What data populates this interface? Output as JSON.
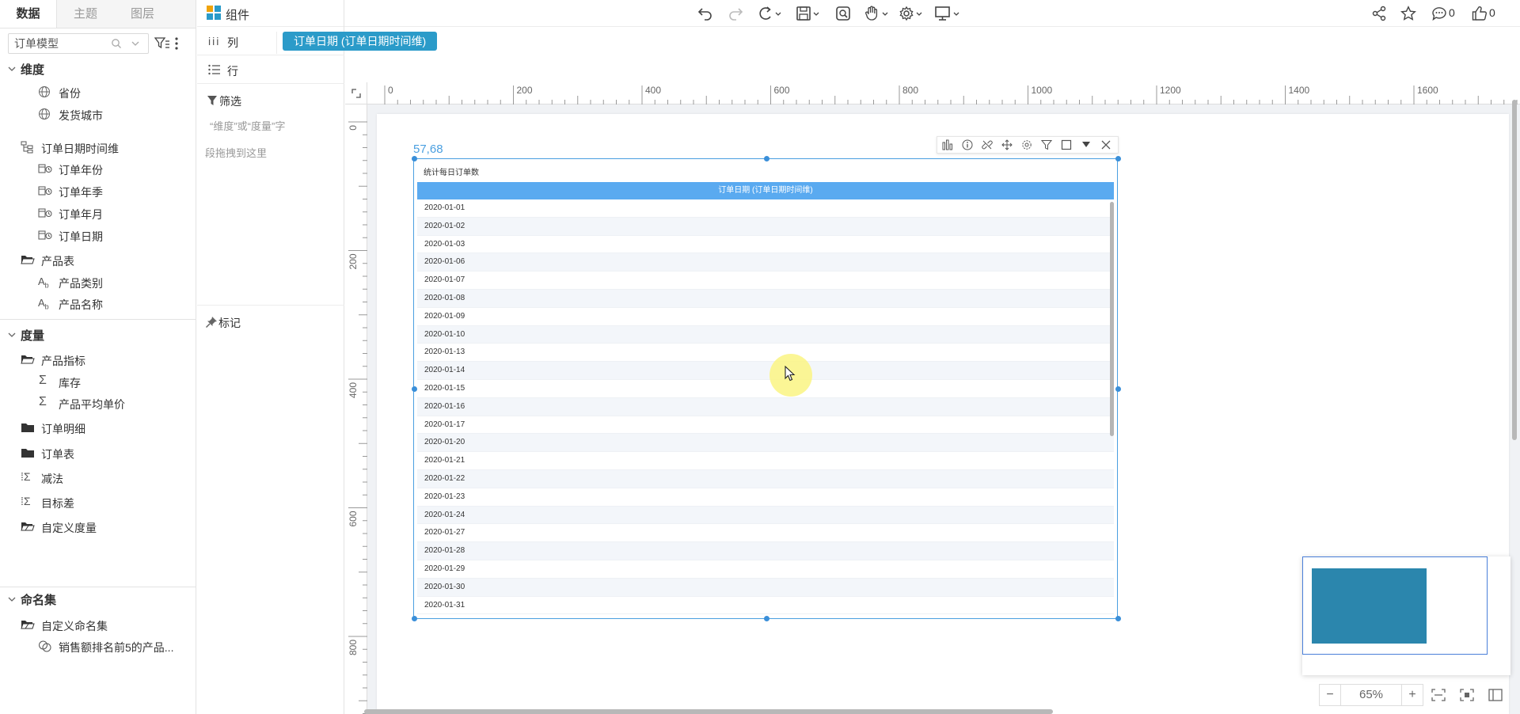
{
  "left_tabs": [
    "数据",
    "主题",
    "图层"
  ],
  "model_select": {
    "value": "订单模型"
  },
  "sections": {
    "dimension": "维度",
    "measure": "度量",
    "named_set": "命名集"
  },
  "dimension_items": [
    {
      "label": "省份",
      "icon": "globe-icon"
    },
    {
      "label": "发货城市",
      "icon": "globe-icon"
    },
    {
      "label": "订单日期时间维",
      "icon": "hierarchy-icon"
    },
    {
      "label": "订单年份",
      "icon": "date-icon"
    },
    {
      "label": "订单年季",
      "icon": "date-icon"
    },
    {
      "label": "订单年月",
      "icon": "date-icon"
    },
    {
      "label": "订单日期",
      "icon": "date-icon"
    },
    {
      "label": "产品表",
      "icon": "folder-open-icon"
    },
    {
      "label": "产品类别",
      "icon": "text-field-icon"
    },
    {
      "label": "产品名称",
      "icon": "text-field-icon"
    }
  ],
  "measure_items": [
    {
      "label": "产品指标",
      "icon": "folder-open-icon"
    },
    {
      "label": "库存",
      "icon": "sigma-icon"
    },
    {
      "label": "产品平均单价",
      "icon": "sigma-icon"
    },
    {
      "label": "订单明细",
      "icon": "folder-icon"
    },
    {
      "label": "订单表",
      "icon": "folder-icon"
    },
    {
      "label": "减法",
      "icon": "calc-measure-icon"
    },
    {
      "label": "目标差",
      "icon": "calc-measure-icon"
    },
    {
      "label": "自定义度量",
      "icon": "folder-custom-icon"
    }
  ],
  "named_set_items": [
    {
      "label": "自定义命名集",
      "icon": "folder-custom-icon"
    },
    {
      "label": "销售额排名前5的产品...",
      "icon": "set-icon"
    }
  ],
  "topbar": {
    "component_label": "组件"
  },
  "topbar_counts": {
    "comments": "0",
    "likes": "0"
  },
  "shelf": {
    "columns_label": "列",
    "rows_label": "行",
    "column_pill": "订单日期 (订单日期时间维)",
    "filter_label": "筛选",
    "filter_hint_1": "“维度”或“度量”字",
    "filter_hint_2": "段拖拽到这里",
    "marks_label": "标记"
  },
  "ruler_h": [
    "0",
    "200",
    "400",
    "600",
    "800",
    "1000",
    "1200",
    "1400",
    "1600"
  ],
  "ruler_v": [
    "0",
    "200",
    "400",
    "600",
    "800"
  ],
  "widget": {
    "coord": "57,68",
    "title": "统计每日订单数",
    "header": "订单日期 (订单日期时间维)",
    "rows": [
      "2020-01-01",
      "2020-01-02",
      "2020-01-03",
      "2020-01-06",
      "2020-01-07",
      "2020-01-08",
      "2020-01-09",
      "2020-01-10",
      "2020-01-13",
      "2020-01-14",
      "2020-01-15",
      "2020-01-16",
      "2020-01-17",
      "2020-01-20",
      "2020-01-21",
      "2020-01-22",
      "2020-01-23",
      "2020-01-24",
      "2020-01-27",
      "2020-01-28",
      "2020-01-29",
      "2020-01-30",
      "2020-01-31"
    ]
  },
  "zoom": {
    "value": "65%",
    "minus": "−",
    "plus": "+"
  },
  "colors": {
    "accent": "#2b9bc9",
    "header": "#5aaaf0",
    "selection": "#4a9fe0",
    "minimap": "#2b86ad"
  }
}
